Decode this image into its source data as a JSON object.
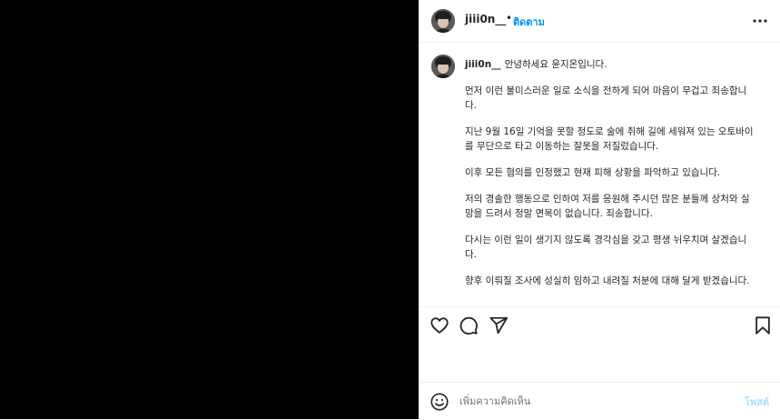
{
  "post": {
    "username": "jiii0n__",
    "dot": "•",
    "follow_label": "ติดตาม",
    "caption": {
      "username": "jiii0n__",
      "paragraphs": [
        "안녕하세요 윤지온입니다.",
        "먼저 이런 불미스러운 일로 소식을 전하게 되어 마음이 무겁고 죄송합니다.",
        "지난 9월 16일 기억을 못할 정도로 술에 취해 길에 세워져 있는 오토바이를 무단으로 타고 이동하는 잘못을 저질렀습니다.",
        "이후 모든 혐의를 인정했고 현재 피해 상황을 파악하고 있습니다.",
        "저의 경솔한 행동으로 인하여 저를 응원해 주시던 많은 분들께 상처와 실망을 드려서 정말 면목이 없습니다. 죄송합니다.",
        "다시는 이런 일이 생기지 않도록 경각심을 갖고 평생 뉘우치며 살겠습니다.",
        "향후 이뤄질 조사에 성실히 임하고 내려질 처분에 대해 달게 받겠습니다."
      ]
    }
  },
  "icons": {
    "more": "more-options-icon",
    "like": "heart-icon",
    "comment": "comment-icon",
    "share": "paper-plane-icon",
    "save": "bookmark-icon",
    "emoji": "emoji-icon"
  },
  "comment_box": {
    "placeholder": "เพิ่มความคิดเห็น",
    "post_label": "โพสต์"
  },
  "colors": {
    "media_bg": "#000000",
    "accent": "#0095f6",
    "post_disabled": "#b2dffc"
  }
}
